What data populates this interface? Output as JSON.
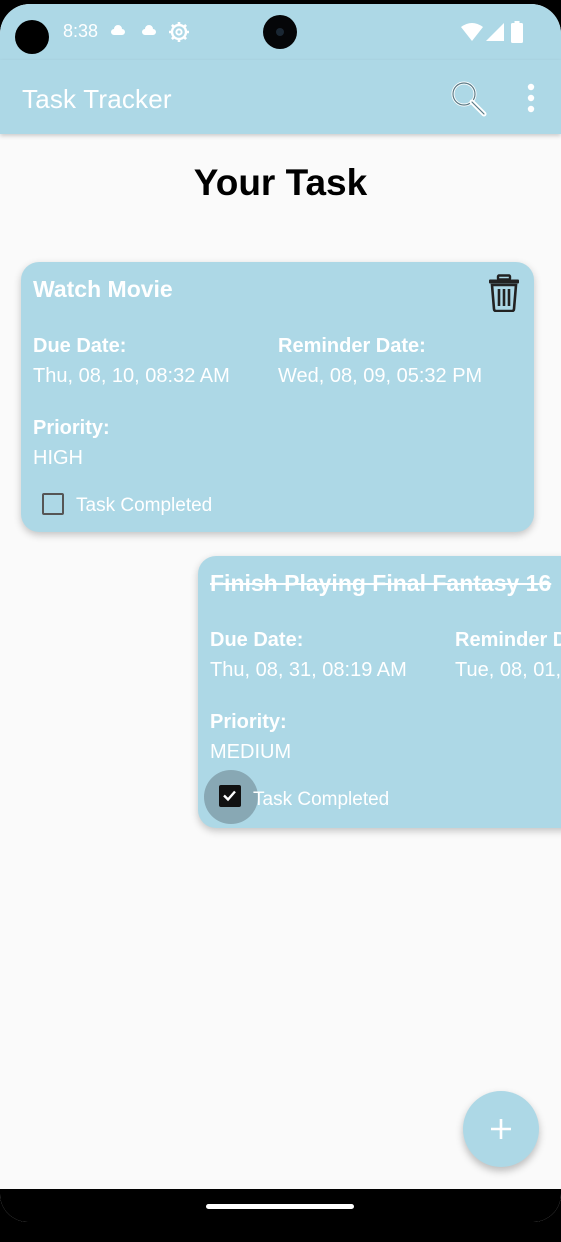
{
  "status_bar": {
    "time": "8:38",
    "icons": [
      "cloud-icon",
      "cloud-icon",
      "settings-gear-icon",
      "wifi-icon",
      "signal-icon",
      "battery-icon"
    ]
  },
  "app_bar": {
    "title": "Task Tracker",
    "actions": [
      "search-icon",
      "more-vert-icon"
    ]
  },
  "page": {
    "title": "Your Task"
  },
  "tasks": [
    {
      "title": "Watch Movie",
      "due_label": "Due Date:",
      "due_value": "Thu, 08, 10, 08:32 AM",
      "reminder_label": "Reminder Date:",
      "reminder_value": "Wed, 08, 09, 05:32 PM",
      "priority_label": "Priority:",
      "priority_value": "HIGH",
      "completed_label": "Task Completed",
      "completed": false
    },
    {
      "title": "Finish Playing Final Fantasy 16",
      "due_label": "Due Date:",
      "due_value": "Thu, 08, 31, 08:19 AM",
      "reminder_label": "Reminder D",
      "reminder_value": "Tue, 08, 01,",
      "priority_label": "Priority:",
      "priority_value": "MEDIUM",
      "completed_label": "Task Completed",
      "completed": true
    }
  ],
  "fab": {
    "icon": "plus-icon"
  },
  "colors": {
    "accent": "#add8e6",
    "background": "#fafafa",
    "text_on_accent": "#ffffff"
  }
}
